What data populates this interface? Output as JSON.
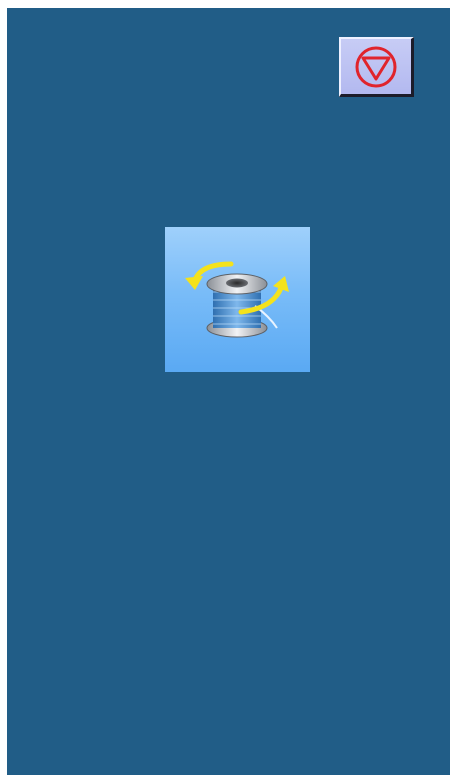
{
  "screen": {
    "background_color": "#215d87"
  },
  "stop_button": {
    "icon": "stop-triangle-icon",
    "accent_color": "#e0242c",
    "face_color": "#c0c6f4"
  },
  "winder_button": {
    "icon": "bobbin-winder-icon",
    "face_color": "#7cbdf8",
    "arrow_color": "#f4e21c"
  }
}
